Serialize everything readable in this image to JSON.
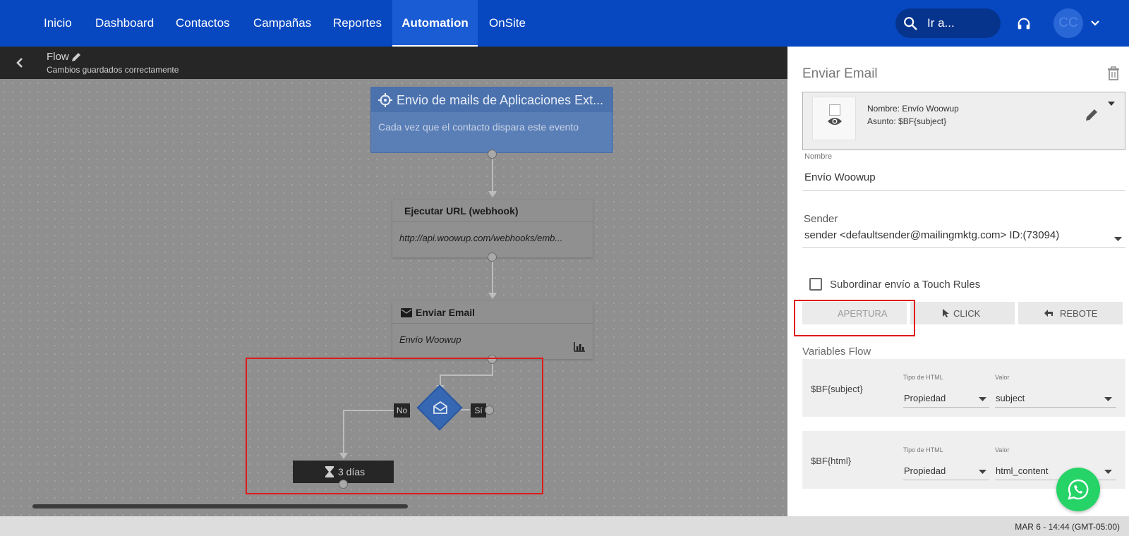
{
  "nav": {
    "items": [
      {
        "label": "Inicio"
      },
      {
        "label": "Dashboard"
      },
      {
        "label": "Contactos"
      },
      {
        "label": "Campañas"
      },
      {
        "label": "Reportes"
      },
      {
        "label": "Automation",
        "active": true
      },
      {
        "label": "OnSite"
      }
    ],
    "search_label": "Ir a...",
    "avatar_initials": "CC"
  },
  "flowbar": {
    "title": "Flow",
    "status": "Cambios guardados correctamente"
  },
  "canvas": {
    "trigger": {
      "title": "Envio de mails de Aplicaciones Ext...",
      "description": "Cada vez que el contacto dispara este evento"
    },
    "webhook": {
      "title": "Ejecutar URL (webhook)",
      "url": "http://api.woowup.com/webhooks/emb..."
    },
    "send_email": {
      "title": "Enviar Email",
      "body": "Envío Woowup"
    },
    "decision": {
      "no_label": "No",
      "yes_label": "Sí"
    },
    "wait": {
      "label": "3 días"
    }
  },
  "panel": {
    "title": "Enviar Email",
    "email_card": {
      "name_line": "Nombre: Envío Woowup",
      "subject_line": "Asunto: $BF{subject}"
    },
    "nombre_label": "Nombre",
    "nombre_value": "Envío Woowup",
    "sender_label": "Sender",
    "sender_value": "sender <defaultsender@mailingmktg.com> ID:(73094)",
    "touch_rules_label": "Subordinar envío a Touch Rules",
    "touch_rules_checked": false,
    "buttons": {
      "apertura": "APERTURA",
      "click": "CLICK",
      "rebote": "REBOTE"
    },
    "variables_title": "Variables Flow",
    "variables": [
      {
        "name": "$BF{subject}",
        "type_label": "Tipo de HTML",
        "type_value": "Propiedad",
        "value_label": "Valor",
        "value": "subject"
      },
      {
        "name": "$BF{html}",
        "type_label": "Tipo de HTML",
        "type_value": "Propiedad",
        "value_label": "Valor",
        "value": "html_content"
      }
    ]
  },
  "status_bar": {
    "datetime": "MAR 6 - 14:44 (GMT-05:00)"
  },
  "colors": {
    "nav_bg": "#0748c1",
    "highlight_red": "#e01b1b",
    "whatsapp": "#25d366"
  }
}
